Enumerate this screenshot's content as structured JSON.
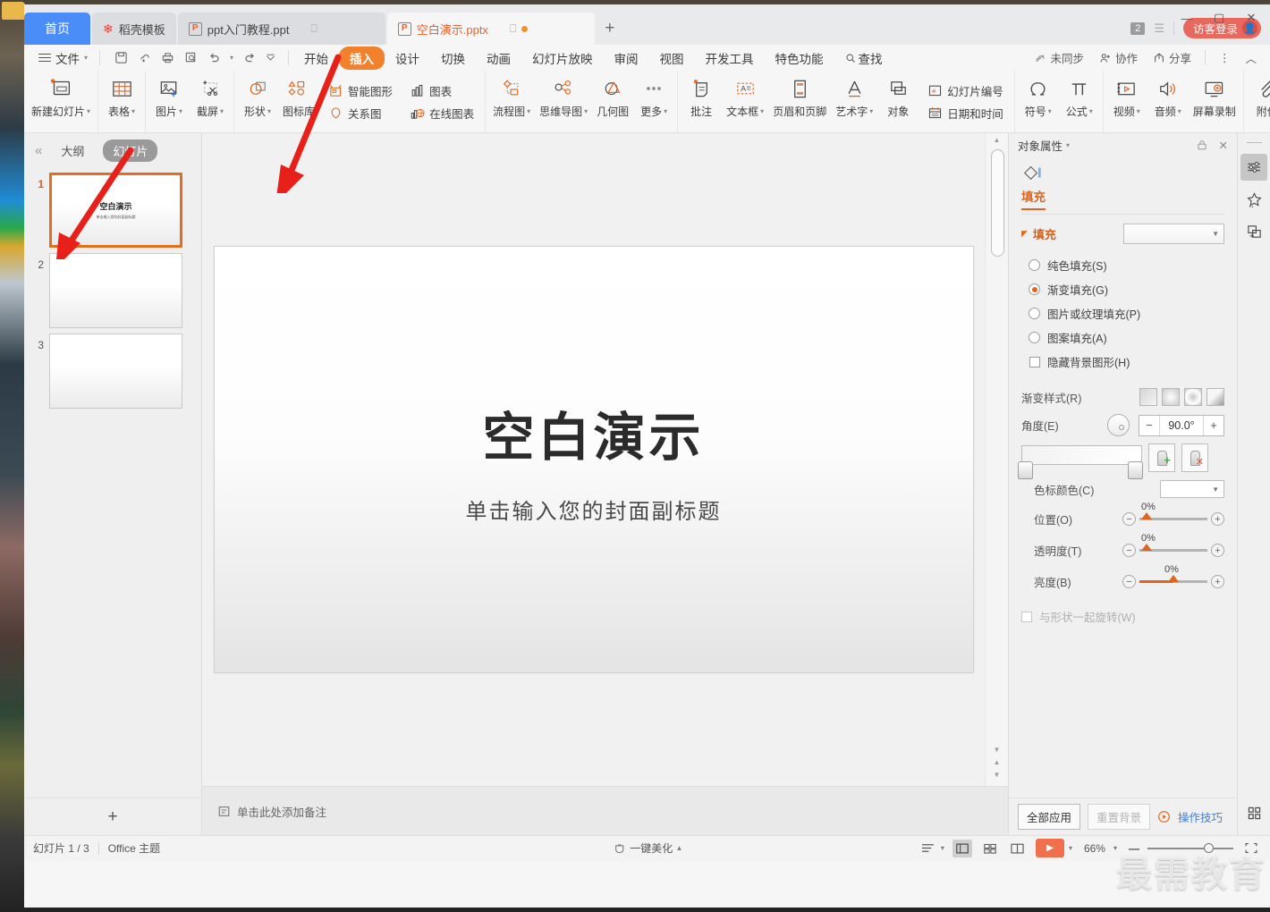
{
  "window": {
    "minimize": "—",
    "maximize": "▢",
    "close": "✕"
  },
  "tabs": {
    "items": [
      {
        "label": "首页",
        "type": "home"
      },
      {
        "label": "稻壳模板",
        "icon": "flower-icon",
        "type": "normal"
      },
      {
        "label": "ppt入门教程.ppt",
        "icon": "pptx-icon",
        "type": "normal"
      },
      {
        "label": "空白演示.pptx",
        "icon": "pptx-icon",
        "type": "active"
      }
    ],
    "new_tab": "+",
    "count_badge": "2",
    "guest_login": "访客登录"
  },
  "menubar": {
    "file": "文件",
    "quick_access": [
      "save-icon",
      "cloud-sync-icon",
      "print-icon",
      "print-preview-icon",
      "undo-icon",
      "redo-icon",
      "customize-icon"
    ],
    "items": [
      {
        "label": "开始",
        "active": false
      },
      {
        "label": "插入",
        "active": true
      },
      {
        "label": "设计",
        "active": false
      },
      {
        "label": "切换",
        "active": false
      },
      {
        "label": "动画",
        "active": false
      },
      {
        "label": "幻灯片放映",
        "active": false
      },
      {
        "label": "审阅",
        "active": false
      },
      {
        "label": "视图",
        "active": false
      },
      {
        "label": "开发工具",
        "active": false
      },
      {
        "label": "特色功能",
        "active": false
      }
    ],
    "find": "查找",
    "right": [
      {
        "label": "未同步",
        "icon": "cloud-off-icon"
      },
      {
        "label": "协作",
        "icon": "collab-icon"
      },
      {
        "label": "分享",
        "icon": "share-icon"
      }
    ],
    "more": "⋮",
    "collapse": "︿"
  },
  "ribbon": {
    "groups": [
      {
        "large": [
          {
            "label": "新建幻灯片",
            "icon": "new-slide-icon",
            "dropdown": true
          }
        ]
      },
      {
        "large": [
          {
            "label": "表格",
            "icon": "table-icon",
            "dropdown": true
          }
        ]
      },
      {
        "large": [
          {
            "label": "图片",
            "icon": "picture-icon",
            "dropdown": true
          },
          {
            "label": "截屏",
            "icon": "screenshot-icon",
            "dropdown": true
          }
        ]
      },
      {
        "large": [
          {
            "label": "形状",
            "icon": "shapes-icon",
            "dropdown": true
          },
          {
            "label": "图标库",
            "icon": "icon-library-icon",
            "dropdown": false
          }
        ],
        "small": [
          {
            "label": "智能图形",
            "icon": "smartart-icon"
          },
          {
            "label": "关系图",
            "icon": "relation-diagram-icon"
          }
        ],
        "small2": [
          {
            "label": "图表",
            "icon": "chart-icon"
          },
          {
            "label": "在线图表",
            "icon": "online-chart-icon"
          }
        ]
      },
      {
        "large": [
          {
            "label": "流程图",
            "icon": "flowchart-icon",
            "dropdown": true
          },
          {
            "label": "思维导图",
            "icon": "mindmap-icon",
            "dropdown": true
          },
          {
            "label": "几何图",
            "icon": "geometry-icon",
            "dropdown": false
          },
          {
            "label": "更多",
            "icon": "more-dots-icon",
            "dropdown": true
          }
        ]
      },
      {
        "large": [
          {
            "label": "批注",
            "icon": "comment-icon",
            "dropdown": false
          },
          {
            "label": "文本框",
            "icon": "textbox-icon",
            "dropdown": true
          },
          {
            "label": "页眉和页脚",
            "icon": "header-footer-icon",
            "dropdown": false
          },
          {
            "label": "艺术字",
            "icon": "wordart-icon",
            "dropdown": true
          },
          {
            "label": "对象",
            "icon": "object-icon",
            "dropdown": false
          }
        ],
        "small": [
          {
            "label": "幻灯片编号",
            "icon": "slide-number-icon"
          },
          {
            "label": "日期和时间",
            "icon": "date-time-icon"
          }
        ]
      },
      {
        "large": [
          {
            "label": "符号",
            "icon": "symbol-icon",
            "dropdown": true
          },
          {
            "label": "公式",
            "icon": "formula-icon",
            "dropdown": true
          }
        ]
      },
      {
        "large": [
          {
            "label": "视频",
            "icon": "video-icon",
            "dropdown": true
          },
          {
            "label": "音频",
            "icon": "audio-icon",
            "dropdown": true
          },
          {
            "label": "屏幕录制",
            "icon": "screen-record-icon",
            "dropdown": false
          }
        ]
      },
      {
        "large": [
          {
            "label": "附件",
            "icon": "attachment-icon",
            "dropdown": false
          }
        ]
      }
    ],
    "scroll_right": "›"
  },
  "slide_panel": {
    "collapse": "«",
    "tab_outline": "大纲",
    "tab_slides": "幻灯片",
    "thumbs": [
      {
        "num": "1",
        "title": "空白演示",
        "sub": "单击输入您的封面副标题",
        "selected": true
      },
      {
        "num": "2",
        "title": "",
        "sub": "",
        "selected": false
      },
      {
        "num": "3",
        "title": "",
        "sub": "",
        "selected": false
      }
    ],
    "add_slide": "+"
  },
  "slide": {
    "title": "空白演示",
    "subtitle": "单击输入您的封面副标题"
  },
  "notes": {
    "icon": "notes-icon",
    "placeholder": "单击此处添加备注"
  },
  "properties": {
    "header_title": "对象属性",
    "header_caret": "▾",
    "lock_icon": "lock-icon",
    "close_icon": "close-icon",
    "shape_icon": "shape-fill-icon",
    "tab_fill": "填充",
    "section_fill": "填充",
    "fill_options": [
      {
        "label": "纯色填充(S)",
        "selected": false
      },
      {
        "label": "渐变填充(G)",
        "selected": true
      },
      {
        "label": "图片或纹理填充(P)",
        "selected": false
      },
      {
        "label": "图案填充(A)",
        "selected": false
      }
    ],
    "hide_bg_graphics": "隐藏背景图形(H)",
    "gradient_style_label": "渐变样式(R)",
    "angle_label": "角度(E)",
    "angle_value": "90.0°",
    "angle_minus": "−",
    "angle_plus": "+",
    "stop_add_title": "add-gradient-stop",
    "stop_remove_title": "remove-gradient-stop",
    "stop_color_label": "色标颜色(C)",
    "position_label": "位置(O)",
    "position_value": "0%",
    "transparency_label": "透明度(T)",
    "transparency_value": "0%",
    "brightness_label": "亮度(B)",
    "brightness_value": "0%",
    "rotate_with_shape": "与形状一起旋转(W)",
    "apply_all": "全部应用",
    "reset_bg": "重置背景",
    "tips": "操作技巧",
    "tips_icon": "play-circle-icon"
  },
  "rail": {
    "items": [
      {
        "icon": "properties-panel-icon",
        "active": true
      },
      {
        "icon": "effects-icon",
        "active": false
      },
      {
        "icon": "selection-pane-icon",
        "active": false
      }
    ],
    "bottom_icon": "grid-apps-icon"
  },
  "status": {
    "slide_counter": "幻灯片 1 / 3",
    "theme": "Office 主题",
    "beautify": "一键美化",
    "beautify_caret": "▴",
    "beautify_icon": "magic-icon",
    "views": [
      {
        "icon": "outline-view-icon",
        "active": false
      },
      {
        "icon": "normal-view-icon",
        "active": true
      },
      {
        "icon": "sorter-view-icon",
        "active": false
      },
      {
        "icon": "reading-view-icon",
        "active": false
      }
    ],
    "play": "▶",
    "play_caret": "▾",
    "zoom": "66%",
    "zoom_caret": "▾",
    "zoom_out": "—",
    "fit_icon": "fit-slide-icon"
  },
  "watermark": "最需教育",
  "colors": {
    "accent_orange": "#f2812e",
    "tab_blue": "#4b8df8",
    "brand_red": "#e9685e",
    "link_blue": "#3f7fd4",
    "play_orange": "#f06f4d",
    "arrow_red": "#e8201a"
  }
}
